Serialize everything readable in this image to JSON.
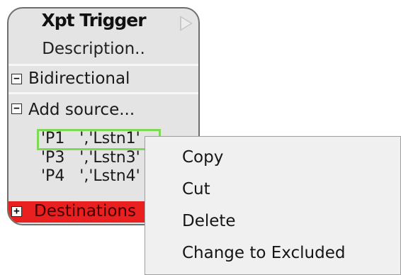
{
  "node": {
    "title": "Xpt Trigger",
    "description": "Description..",
    "sections": {
      "bidirectional": {
        "toggle": "−",
        "label": "Bidirectional"
      },
      "add_source": {
        "toggle": "−",
        "label": "Add source..."
      },
      "destinations": {
        "toggle": "+",
        "label": "Destinations"
      }
    },
    "sources": [
      {
        "text": "'P1   ','Lstn1'"
      },
      {
        "text": "'P3   ','Lstn3'"
      },
      {
        "text": "'P4   ','Lstn4'"
      }
    ],
    "colors": {
      "selected_outline": "#7ed957",
      "destinations_bg": "#ea2020"
    }
  },
  "context_menu": {
    "items": [
      {
        "label": "Copy"
      },
      {
        "label": "Cut"
      },
      {
        "label": "Delete"
      },
      {
        "label": "Change to Excluded"
      }
    ]
  }
}
